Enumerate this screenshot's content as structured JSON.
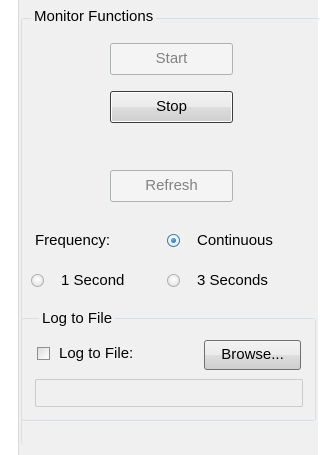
{
  "monitor_group": {
    "title": "Monitor Functions",
    "start_label": "Start",
    "stop_label": "Stop",
    "refresh_label": "Refresh"
  },
  "frequency": {
    "label": "Frequency:",
    "options": [
      {
        "label": "Continuous",
        "selected": true
      },
      {
        "label": "1 Second",
        "selected": false
      },
      {
        "label": "3 Seconds",
        "selected": false
      }
    ]
  },
  "log_group": {
    "title": "Log to File",
    "checkbox_label": "Log to File:",
    "checkbox_checked": false,
    "browse_label": "Browse...",
    "file_path": ""
  },
  "colors": {
    "panel_bg": "#f0f0f0",
    "radio_accent": "#1b5fa3",
    "disabled_text": "#838383"
  }
}
